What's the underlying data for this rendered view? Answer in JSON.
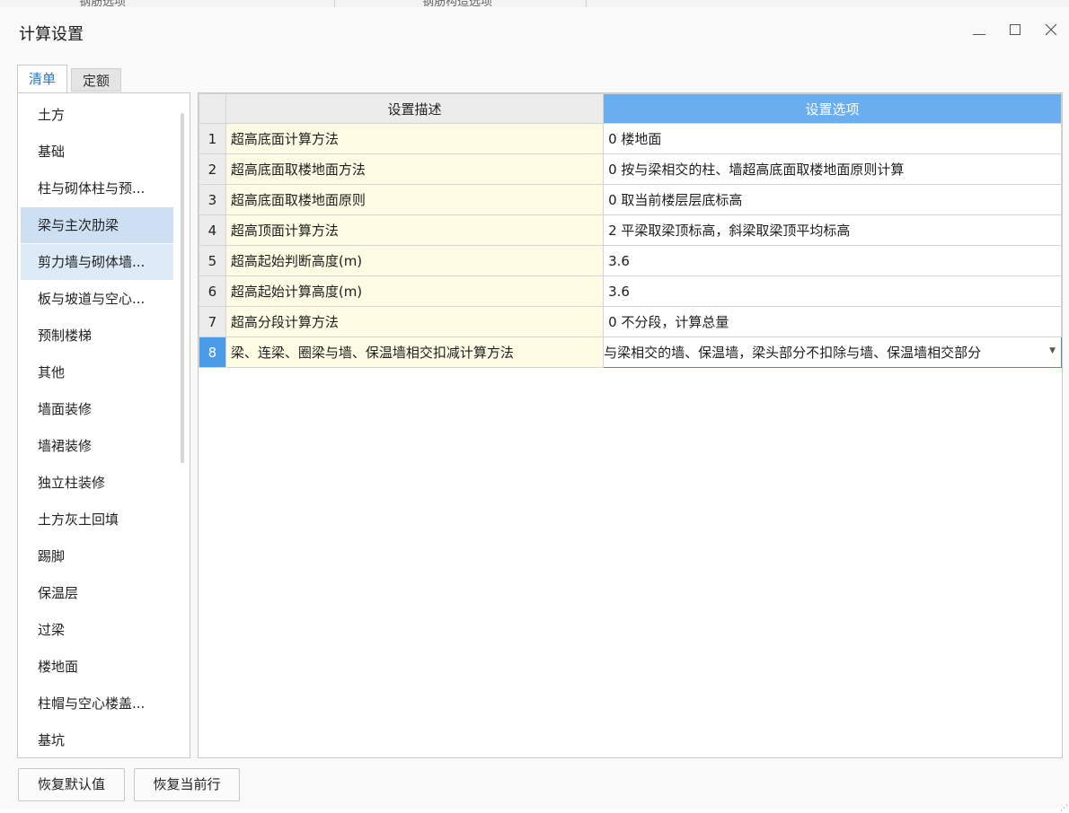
{
  "background_tabs": [
    "钢筋选项",
    "钢筋构造选项"
  ],
  "dialog": {
    "title": "计算设置"
  },
  "tabs": [
    {
      "label": "清单"
    },
    {
      "label": "定额"
    }
  ],
  "categories": [
    "土方",
    "基础",
    "柱与砌体柱与预...",
    "梁与主次肋梁",
    "剪力墙与砌体墙...",
    "板与坡道与空心...",
    "预制楼梯",
    "其他",
    "墙面装修",
    "墙裙装修",
    "独立柱装修",
    "土方灰土回填",
    "踢脚",
    "保温层",
    "过梁",
    "楼地面",
    "柱帽与空心楼盖...",
    "基坑"
  ],
  "table": {
    "headers": {
      "description": "设置描述",
      "option": "设置选项"
    },
    "rows": [
      {
        "num": "1",
        "desc": "超高底面计算方法",
        "opt": "0 楼地面"
      },
      {
        "num": "2",
        "desc": "超高底面取楼地面方法",
        "opt": "0 按与梁相交的柱、墙超高底面取楼地面原则计算"
      },
      {
        "num": "3",
        "desc": "超高底面取楼地面原则",
        "opt": "0 取当前楼层层底标高"
      },
      {
        "num": "4",
        "desc": "超高顶面计算方法",
        "opt": "2 平梁取梁顶标高，斜梁取梁顶平均标高"
      },
      {
        "num": "5",
        "desc": "超高起始判断高度(m)",
        "opt": "3.6"
      },
      {
        "num": "6",
        "desc": "超高起始计算高度(m)",
        "opt": "3.6"
      },
      {
        "num": "7",
        "desc": "超高分段计算方法",
        "opt": "0 不分段，计算总量"
      },
      {
        "num": "8",
        "desc": "梁、连梁、圈梁与墙、保温墙相交扣减计算方法",
        "opt": "与梁相交的墙、保温墙，梁头部分不扣除与墙、保温墙相交部分"
      }
    ]
  },
  "buttons": {
    "reset_default": "恢复默认值",
    "reset_row": "恢复当前行"
  },
  "colors": {
    "accent": "#1e78d7",
    "header_selected": "#6aaef0",
    "desc_bg": "#fefbe4",
    "list_selected": "#cde0f3"
  }
}
